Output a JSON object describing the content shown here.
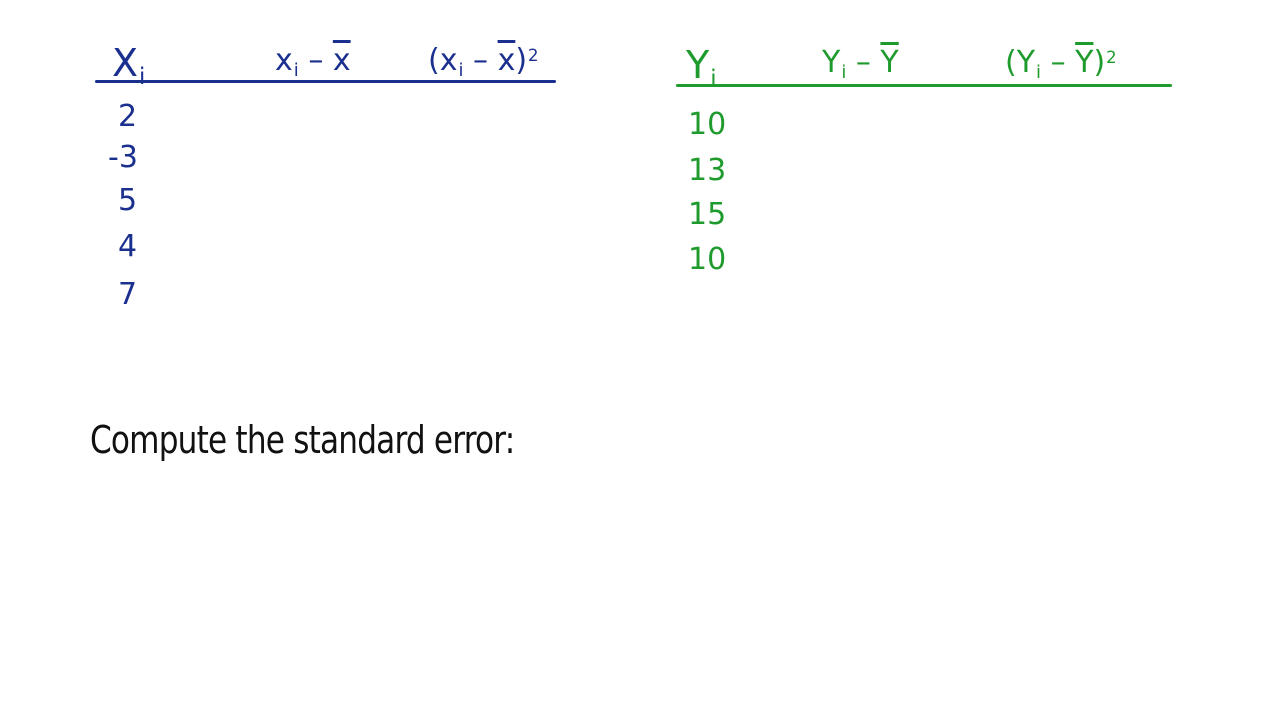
{
  "left_table": {
    "color": "#1b2f8f",
    "headers": {
      "main": "X",
      "main_sub": "i",
      "dev_a": "x",
      "dev_a_sub": "i",
      "dev_a_rest": " – ",
      "dev_a_bar": "x",
      "sq_open": "(x",
      "sq_sub": "i",
      "sq_mid": " – ",
      "sq_bar": "x",
      "sq_close": ")",
      "sq_pow": "2"
    },
    "values": [
      "2",
      "-3",
      "5",
      "4",
      "7"
    ]
  },
  "right_table": {
    "color": "#1f9b2e",
    "headers": {
      "main": "Y",
      "main_sub": "i",
      "dev_a": "Y",
      "dev_a_sub": "i",
      "dev_a_rest": " – ",
      "dev_a_bar": "Y",
      "sq_open": "(Y",
      "sq_sub": "i",
      "sq_mid": " – ",
      "sq_bar": "Y",
      "sq_close": ")",
      "sq_pow": "2"
    },
    "values": [
      "10",
      "13",
      "15",
      "10"
    ]
  },
  "prompt": "Compute the standard error:"
}
